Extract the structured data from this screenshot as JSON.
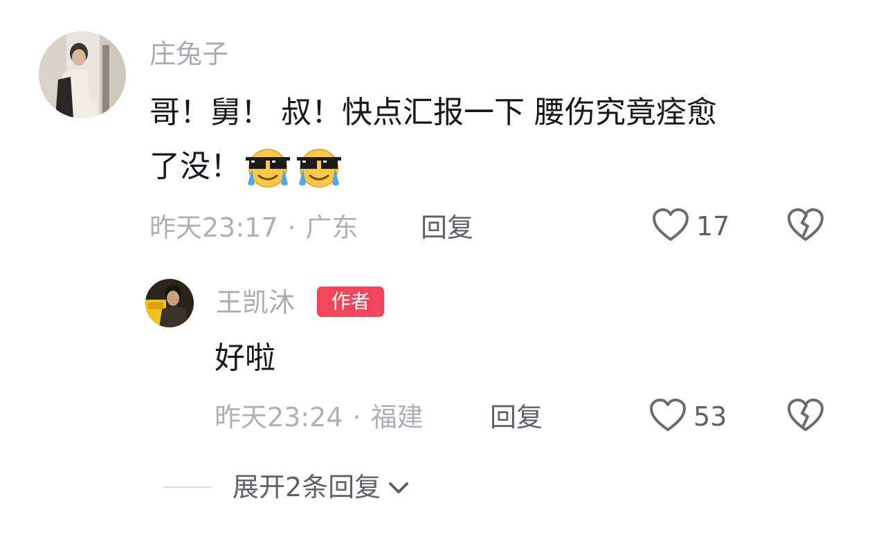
{
  "comment": {
    "username": "庄兔子",
    "text_line1": "哥！舅！ 叔！快点汇报一下 腰伤究竟痊愈",
    "text_line2": "了没！",
    "emojis": [
      "crying-sunglasses-emoji",
      "crying-sunglasses-emoji"
    ],
    "time": "昨天23:17",
    "separator": "·",
    "location": "广东",
    "reply_label": "回复",
    "likes": "17"
  },
  "reply": {
    "username": "王凯沐",
    "badge": "作者",
    "badge_color": "#f0455a",
    "text": "好啦",
    "time": "昨天23:24",
    "separator": "·",
    "location": "福建",
    "reply_label": "回复",
    "likes": "53"
  },
  "expand": {
    "label": "展开2条回复"
  },
  "icons": {
    "like": "heart-outline-icon",
    "dislike": "broken-heart-icon",
    "expand": "chevron-down-icon"
  }
}
